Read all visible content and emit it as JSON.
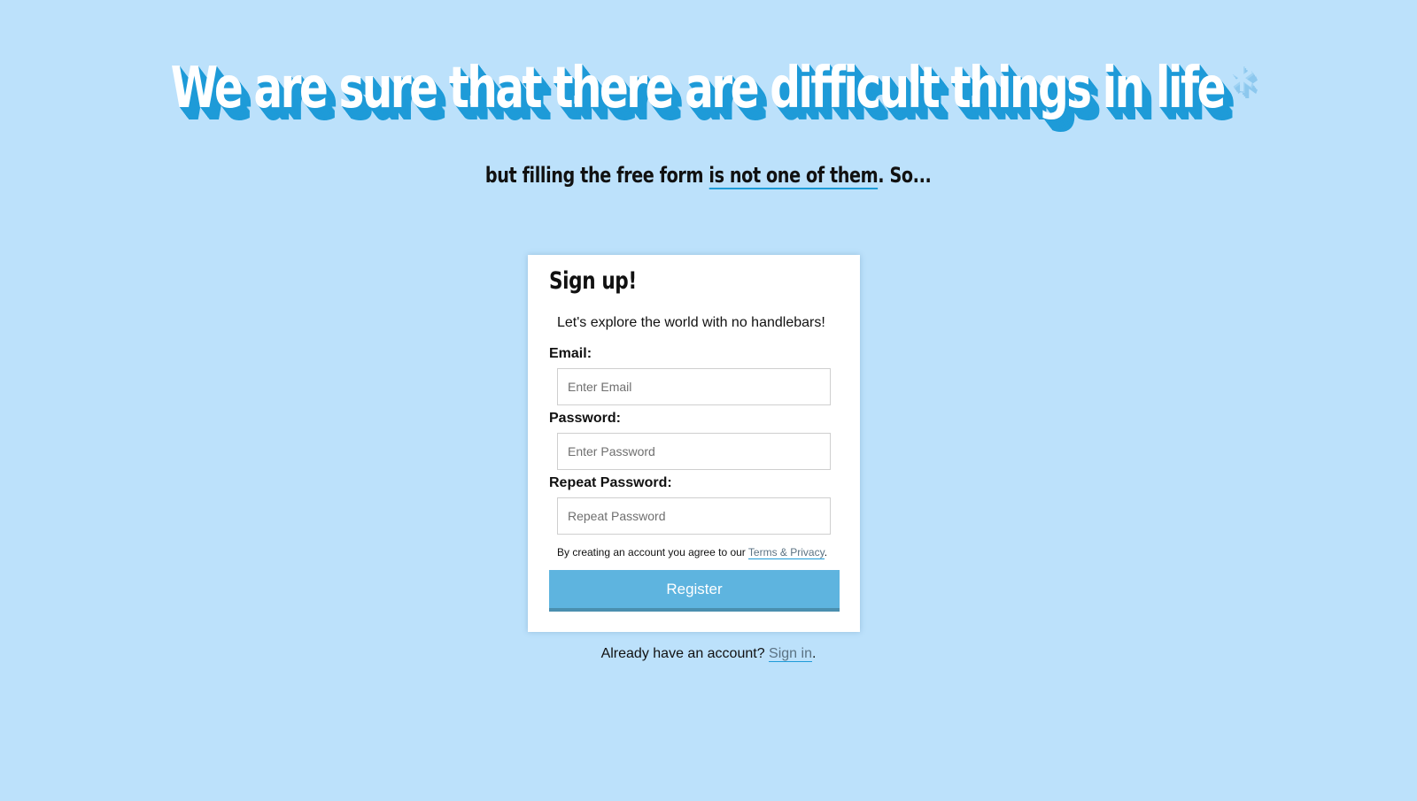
{
  "colors": {
    "background": "#bce1fb",
    "accent": "#1e9bd8",
    "button": "#5eb4df",
    "card": "#ffffff"
  },
  "hero": {
    "title": "We are sure that there are difficult things in life",
    "asterisk": "*",
    "subtitle_start": "but filling the free form ",
    "subtitle_highlight": "is not one of them",
    "subtitle_end": ". So..."
  },
  "form": {
    "title": "Sign up!",
    "tagline": "Let's explore the world with no handlebars!",
    "fields": [
      {
        "label": "Email:",
        "placeholder": "Enter Email"
      },
      {
        "label": "Password:",
        "placeholder": "Enter Password"
      },
      {
        "label": "Repeat Password:",
        "placeholder": "Repeat Password"
      }
    ],
    "terms_text": "By creating an account you agree to our ",
    "terms_link": "Terms & Privacy",
    "terms_end": ".",
    "register_label": "Register"
  },
  "footer": {
    "signin_prompt": "Already have an account? ",
    "signin_link": "Sign in",
    "signin_end": "."
  }
}
